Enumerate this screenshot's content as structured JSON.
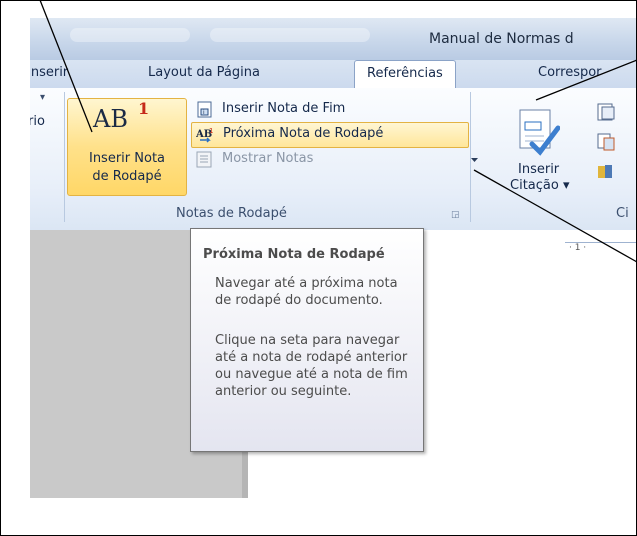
{
  "window": {
    "title": "Manual de Normas d"
  },
  "tabs": [
    {
      "label": "Inserir"
    },
    {
      "label": "Layout da Página"
    },
    {
      "label": "Referências",
      "active": true
    },
    {
      "label": "Correspor"
    }
  ],
  "ribbon": {
    "left_partial_label": "rio",
    "insert_footnote": {
      "icon_text": "AB",
      "icon_sup": "1",
      "label_line1": "Inserir Nota",
      "label_line2": "de Rodapé"
    },
    "insert_endnote_label": "Inserir Nota de Fim",
    "next_footnote_label": "Próxima Nota de Rodapé",
    "show_notes_label": "Mostrar Notas",
    "group_label": "Notas de Rodapé",
    "insert_citation": {
      "label_line1": "Inserir",
      "label_line2": "Citação"
    },
    "next_group_partial": "Ci"
  },
  "ruler_text": "· 1 ·",
  "tooltip": {
    "title": "Próxima Nota de Rodapé",
    "para1": "Navegar até a próxima nota de rodapé do documento.",
    "para2": "Clique na seta para navegar até a nota de rodapé anterior ou navegue até a nota de fim anterior ou seguinte."
  },
  "colors": {
    "accent_hover": "#ffe18a",
    "ribbon_blue": "#dbe6f4",
    "footnote_red": "#c52a1a"
  }
}
